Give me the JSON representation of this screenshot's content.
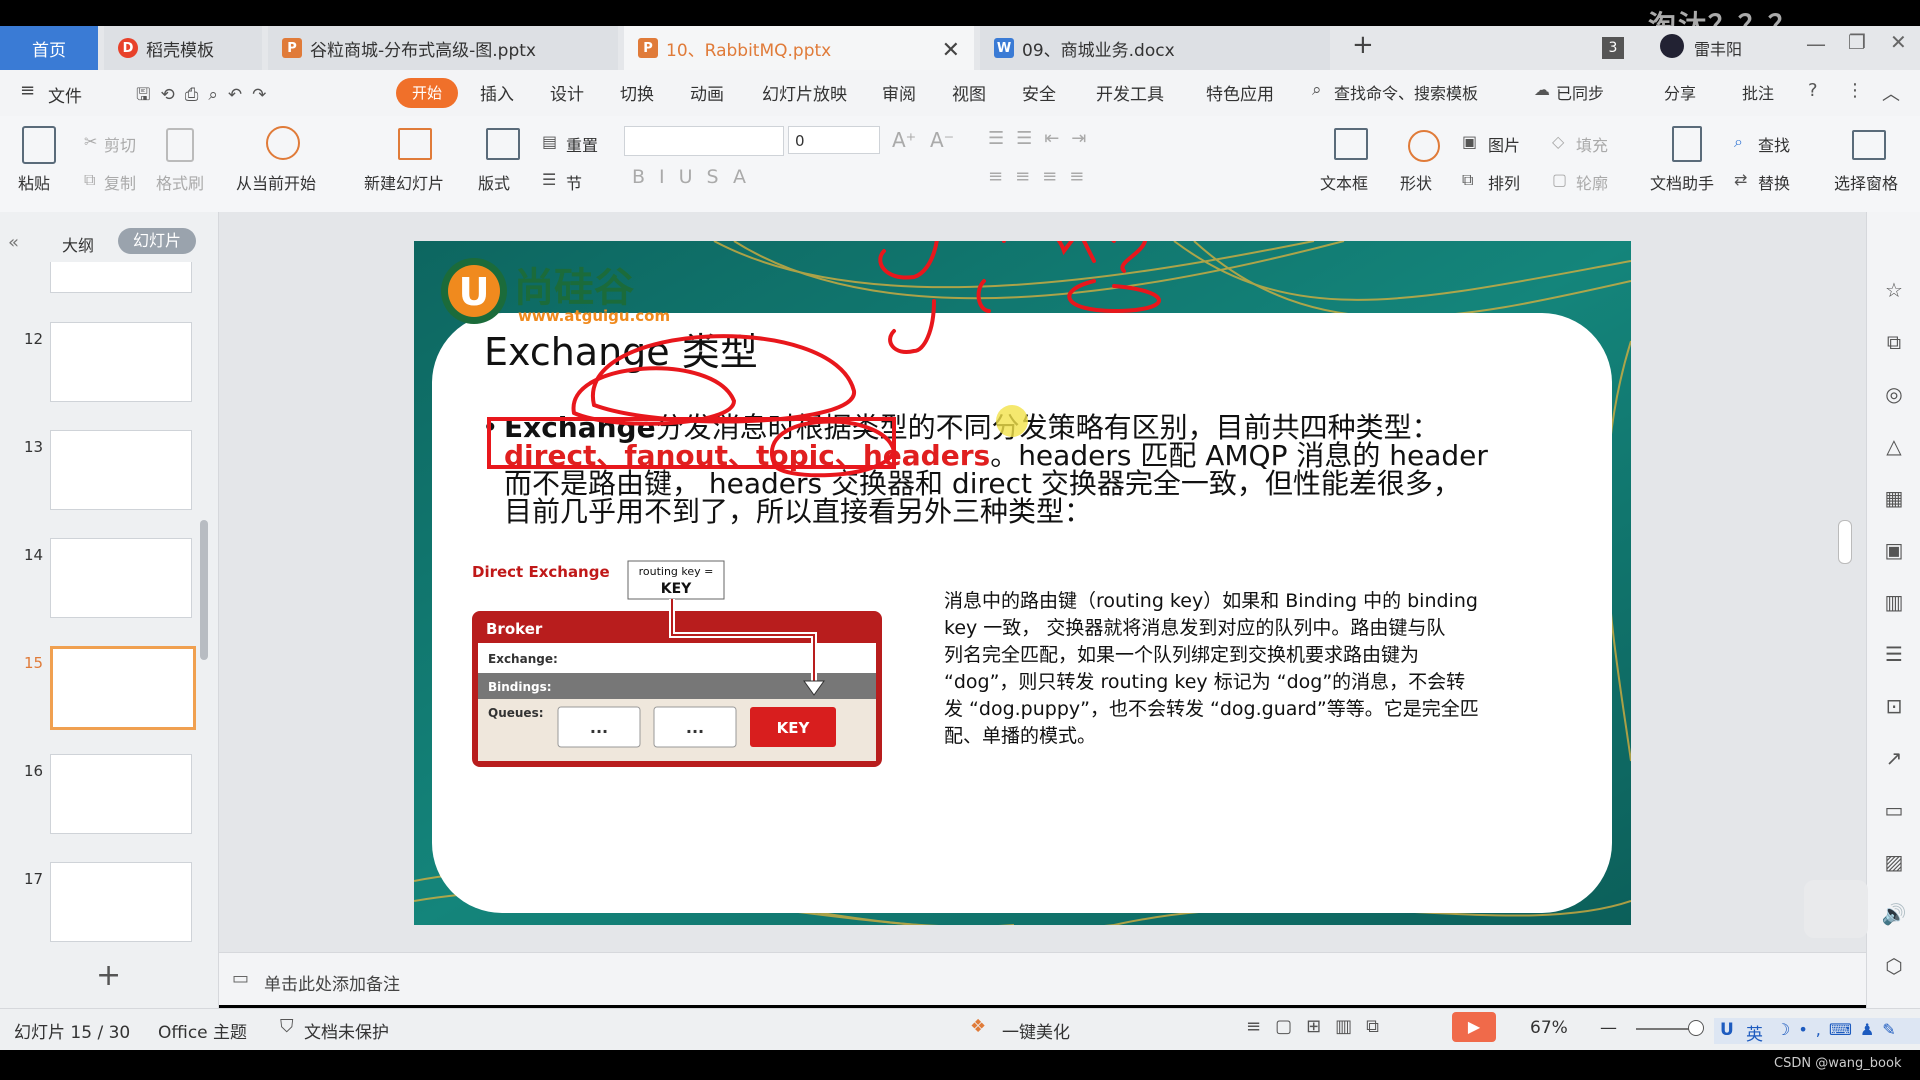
{
  "overlay_text": "淘汰？？？",
  "tabs": {
    "home": "首页",
    "daoke": "稻壳模板",
    "pptx1": "谷粒商城-分布式高级-图.pptx",
    "pptx2": "10、RabbitMQ.pptx",
    "docx": "09、商城业务.docx",
    "badge": "3",
    "user": "雷丰阳"
  },
  "menu": {
    "file": "文件",
    "items": [
      "开始",
      "插入",
      "设计",
      "切换",
      "动画",
      "幻灯片放映",
      "审阅",
      "视图",
      "安全",
      "开发工具",
      "特色应用"
    ],
    "search": "查找命令、搜索模板",
    "synced": "已同步",
    "share": "分享",
    "comment": "批注"
  },
  "tools": {
    "paste": "粘贴",
    "cut": "剪切",
    "copy": "复制",
    "format_painter": "格式刷",
    "play_current": "从当前开始",
    "new_slide": "新建幻灯片",
    "layout": "版式",
    "reset": "重置",
    "section": "节",
    "font_size": "0",
    "textbox": "文本框",
    "shape": "形状",
    "picture": "图片",
    "arrange": "排列",
    "fill": "填充",
    "outline": "轮廓",
    "doc_assistant": "文档助手",
    "find": "查找",
    "replace": "替换",
    "select_pane": "选择窗格"
  },
  "left_panel": {
    "tab_outline": "大纲",
    "tab_slides": "幻灯片",
    "slides": [
      "12",
      "13",
      "14",
      "15",
      "16",
      "17"
    ],
    "current": "15"
  },
  "slide": {
    "logo_text": "尚硅谷",
    "logo_url": "www.atguigu.com",
    "title": "Exchange 类型",
    "bullet_bold": "Exchange",
    "bullet_rest": "分发消息时根据类型的不同分发策略有区别，目前共四种类型：",
    "types_red": "direct、fanout、topic、headers",
    "types_after": "。headers 匹配 AMQP 消息的 header",
    "line3": "而不是路由键， headers 交换器和 direct 交换器完全一致，但性能差很多，",
    "line4": "目前几乎用不到了，所以直接看另外三种类型：",
    "diagram_title": "Direct Exchange",
    "routing_key_label": "routing key =",
    "routing_key_value": "KEY",
    "broker": "Broker",
    "exchange": "Exchange:",
    "bindings": "Bindings:",
    "queues": "Queues:",
    "queue1": "...",
    "queue2": "...",
    "queue3": "KEY",
    "description": [
      "消息中的路由键（routing key）如果和 Binding 中的 binding",
      "key 一致， 交换器就将消息发到对应的队列中。路由键与队",
      "列名完全匹配，如果一个队列绑定到交换机要求路由键为",
      "“dog”，则只转发 routing key 标记为 “dog”的消息，不会转",
      "发 “dog.puppy”，也不会转发 “dog.guard”等等。它是完全匹",
      "配、单播的模式。"
    ]
  },
  "notes_placeholder": "单击此处添加备注",
  "status": {
    "slide_pos": "幻灯片 15 / 30",
    "theme": "Office 主题",
    "protect": "文档未保护",
    "beautify": "一键美化",
    "zoom": "67%",
    "ime": "英"
  },
  "watermark": "CSDN @wang_book",
  "colors": {
    "accent_orange": "#f0702a",
    "tab_blue": "#3a7bd5",
    "annotation_red": "#e8171c",
    "slide_teal": "#1b7a72",
    "broker_red": "#b81d1d"
  }
}
